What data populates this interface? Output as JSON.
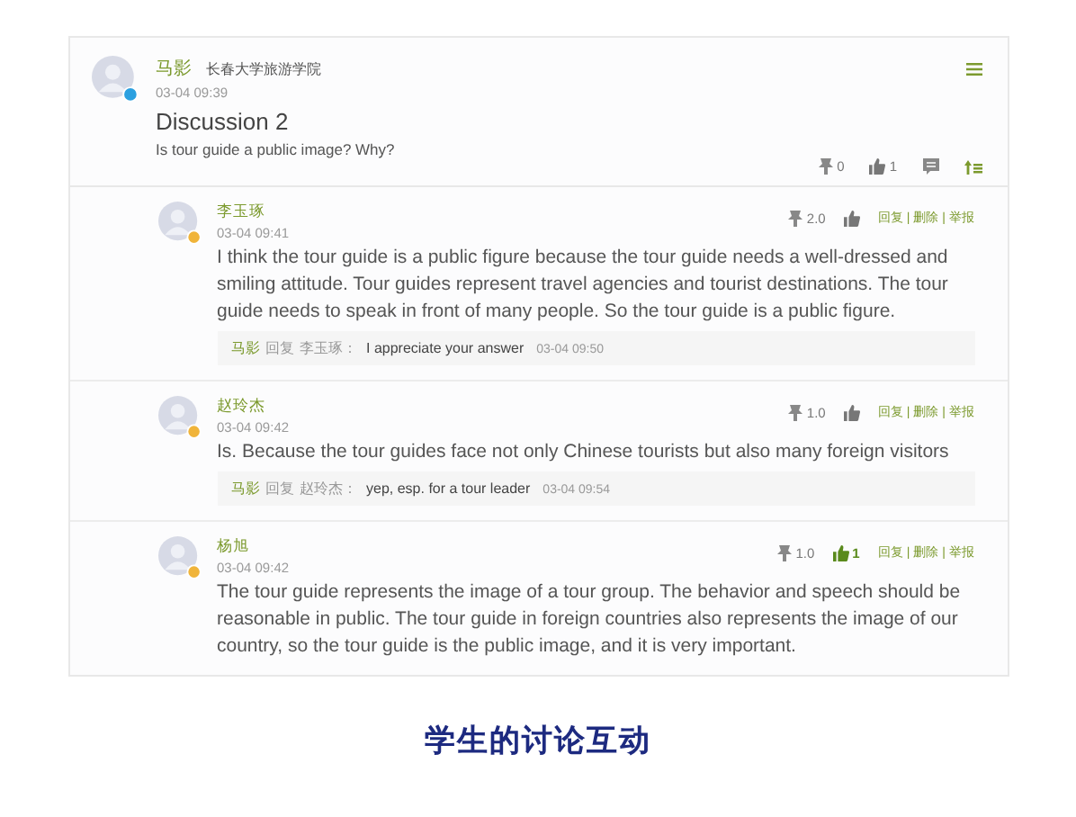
{
  "post": {
    "author": "马影",
    "school": "长春大学旅游学院",
    "kind": "teacher",
    "time": "03-04 09:39",
    "title": "Discussion 2",
    "question": "Is tour guide a public image? Why?",
    "score": "0",
    "likes": "1",
    "liked": false
  },
  "replies": [
    {
      "author": "李玉琢",
      "kind": "student",
      "time": "03-04 09:41",
      "score": "2.0",
      "liked": false,
      "actions": [
        "回复",
        "删除",
        "举报"
      ],
      "separator": "|",
      "text": "I think the tour guide is a public figure because the tour guide needs a well-dressed and smiling attitude. Tour guides represent travel agencies and tourist destinations. The tour guide needs to speak in front of many people. So the tour guide is a public figure.",
      "comment": {
        "author": "马影",
        "verb": "回复",
        "target": "李玉琢：",
        "text": "I appreciate your answer",
        "time": "03-04 09:50"
      }
    },
    {
      "author": "赵玲杰",
      "kind": "student",
      "time": "03-04 09:42",
      "score": "1.0",
      "liked": false,
      "actions": [
        "回复",
        "删除",
        "举报"
      ],
      "separator": "|",
      "text": "Is. Because the tour guides face not only Chinese tourists but also many foreign visitors",
      "comment": {
        "author": "马影",
        "verb": "回复",
        "target": "赵玲杰：",
        "text": "yep, esp. for a tour leader",
        "time": "03-04 09:54"
      }
    },
    {
      "author": "杨旭",
      "kind": "student",
      "time": "03-04 09:42",
      "score": "1.0",
      "liked": true,
      "likes": "1",
      "actions": [
        "回复",
        "删除",
        "举报"
      ],
      "separator": "|",
      "text": "The tour guide represents the image of a tour group. The behavior and speech should be reasonable in public. The tour guide in foreign countries also represents the image of our country, so the tour guide is the public image, and it is very important."
    }
  ],
  "caption": "学生的讨论互动"
}
